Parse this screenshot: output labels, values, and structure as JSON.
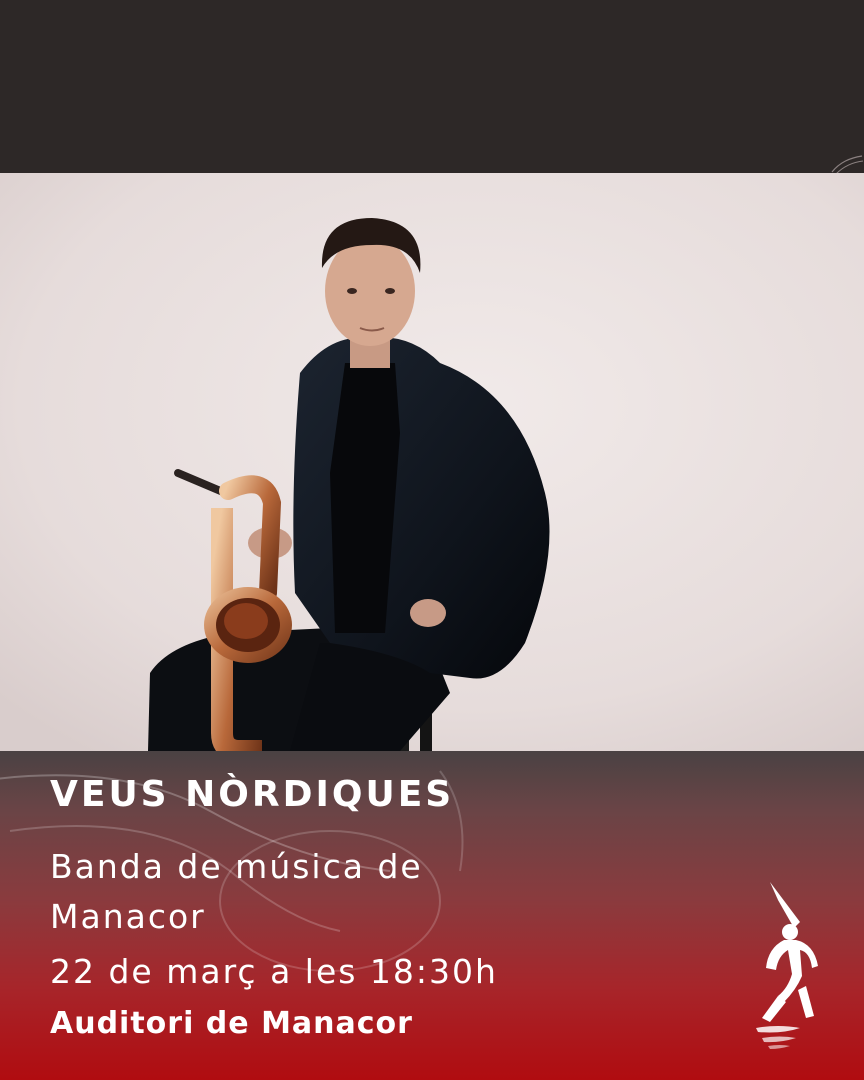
{
  "event": {
    "title": "VEUS NÒRDIQUES",
    "performer": "Banda de música de Manacor",
    "date_time": "22 de març a les 18:30h",
    "venue": "Auditori de Manacor"
  },
  "colors": {
    "top_band": "#2d2827",
    "photo_background": "#e9e0df",
    "accent_red": "#b00c10",
    "text": "#ffffff"
  },
  "icons": {
    "logo": "dancing-figure-logo",
    "photo": "saxophonist-portrait"
  }
}
